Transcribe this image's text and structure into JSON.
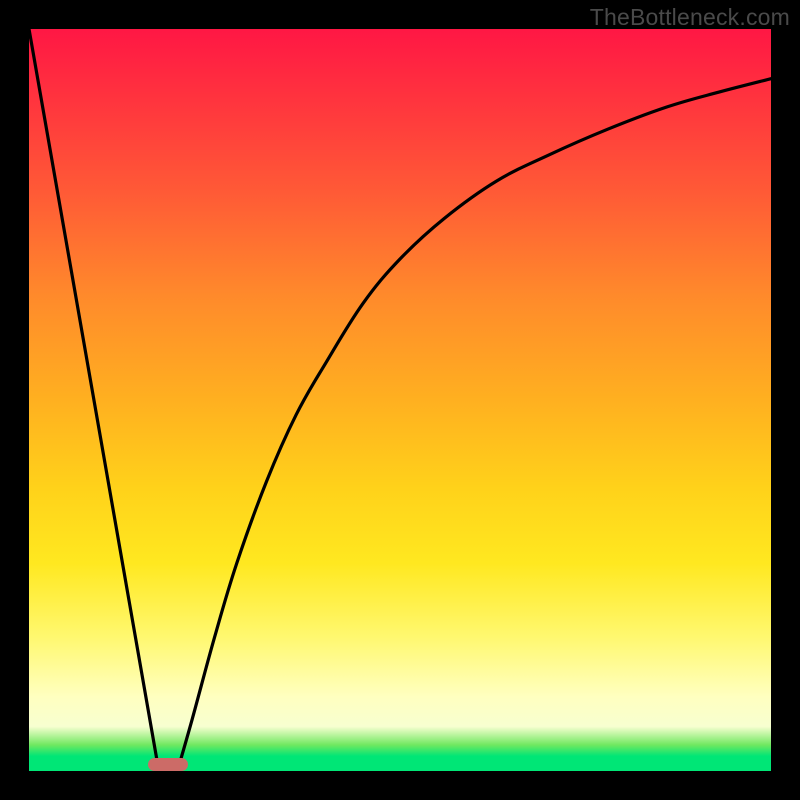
{
  "watermark": "TheBottleneck.com",
  "colors": {
    "frame": "#000000",
    "curve": "#000000",
    "marker": "#cc6b67",
    "gradient_top": "#ff1744",
    "gradient_bottom": "#00e676"
  },
  "chart_data": {
    "type": "line",
    "title": "",
    "xlabel": "",
    "ylabel": "",
    "xlim": [
      0,
      100
    ],
    "ylim": [
      0,
      100
    ],
    "x_ticks": [],
    "y_ticks": [],
    "grid": false,
    "legend": false,
    "series": [
      {
        "name": "left-descending-line",
        "x": [
          0,
          17.5
        ],
        "values": [
          100,
          0
        ]
      },
      {
        "name": "right-rising-curve",
        "x": [
          20,
          22,
          25,
          28,
          32,
          36,
          40,
          45,
          50,
          56,
          63,
          70,
          78,
          86,
          93,
          100
        ],
        "values": [
          0,
          7,
          18,
          28,
          39,
          48,
          55,
          63,
          69,
          74.5,
          79.5,
          83,
          86.5,
          89.5,
          91.5,
          93.3
        ]
      }
    ],
    "annotations": [
      {
        "name": "bottleneck-marker",
        "shape": "rounded-rect",
        "x_center": 18.7,
        "y": 0.9,
        "width_pct": 5.4,
        "height_pct": 1.75
      }
    ]
  }
}
